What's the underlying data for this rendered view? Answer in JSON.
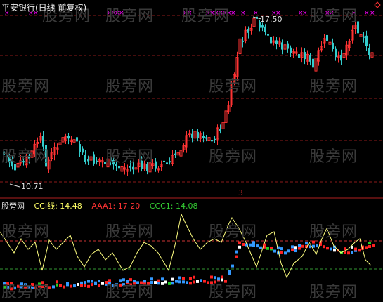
{
  "header": {
    "title": "平安银行(日线 前复权)",
    "max_price_label": "17.50",
    "min_price_label": "10.71",
    "marker_label": "3",
    "diamond_icon": "diamond-icon"
  },
  "watermark": "股旁网",
  "indicator": {
    "name": "股旁网",
    "cci_label": "CCI线: 14.48",
    "aaa_label": "AAA1: 17.20",
    "ccc_label": "CCC1: 14.08",
    "colors": {
      "cci": "#ffff66",
      "aaa": "#ff3333",
      "ccc": "#33cc33"
    }
  },
  "colors": {
    "background": "#000000",
    "up": "#ff3333",
    "down": "#33cccc",
    "grid": "#8b1a1a",
    "signal": "#ff00ff",
    "indicator_line": "#ffff80",
    "dash_red": "#cc3333",
    "dash_green": "#339933",
    "bar_blue": "#3399ff",
    "bar_red": "#ff2222",
    "bar_green": "#22cc22",
    "bar_white": "#ffffff"
  }
}
